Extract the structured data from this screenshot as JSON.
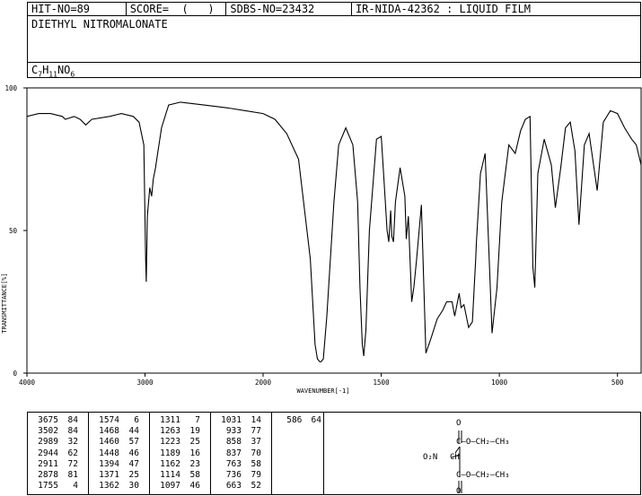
{
  "header": {
    "hit": "HIT-NO=89",
    "score": "SCORE=  (   )",
    "sdbs": "SDBS-NO=23432",
    "ir": "IR-NIDA-42362 : LIQUID FILM"
  },
  "compound_name": "DIETHYL NITROMALONATE",
  "formula": {
    "c": "C",
    "c_n": "7",
    "h": "H",
    "h_n": "11",
    "n": "NO",
    "o_n": "6"
  },
  "chart_data": {
    "type": "line",
    "xlabel": "WAVENUMBER[-1]",
    "ylabel": "TRANSMITTANCE[%]",
    "xlim": [
      4000,
      400
    ],
    "ylim": [
      0,
      100
    ],
    "x_ticks": [
      "4000",
      "3000",
      "2000",
      "1500",
      "1000",
      "500"
    ],
    "y_ticks": [
      "100",
      "50",
      "0"
    ],
    "series": [
      {
        "x": [
          4000,
          3900,
          3800,
          3700,
          3675,
          3600,
          3550,
          3502,
          3450,
          3300,
          3200,
          3100,
          3050,
          3010,
          2995,
          2989,
          2980,
          2960,
          2944,
          2930,
          2911,
          2890,
          2878,
          2860,
          2800,
          2700,
          2500,
          2300,
          2150,
          2000,
          1950,
          1900,
          1850,
          1800,
          1780,
          1770,
          1760,
          1755,
          1745,
          1730,
          1700,
          1680,
          1650,
          1620,
          1600,
          1590,
          1580,
          1574,
          1565,
          1550,
          1520,
          1500,
          1490,
          1475,
          1468,
          1460,
          1455,
          1448,
          1440,
          1420,
          1400,
          1394,
          1385,
          1371,
          1362,
          1350,
          1330,
          1311,
          1290,
          1263,
          1240,
          1223,
          1200,
          1189,
          1170,
          1162,
          1150,
          1130,
          1114,
          1100,
          1097,
          1080,
          1060,
          1031,
          1010,
          990,
          960,
          933,
          910,
          890,
          870,
          858,
          850,
          837,
          810,
          780,
          763,
          740,
          720,
          700,
          680,
          663,
          640,
          620,
          586,
          560,
          530,
          500,
          470,
          440,
          420,
          400
        ],
        "y": [
          90,
          91,
          91,
          90,
          89,
          90,
          89,
          87,
          89,
          90,
          91,
          90,
          88,
          80,
          40,
          32,
          55,
          65,
          62,
          68,
          72,
          78,
          81,
          86,
          94,
          95,
          94,
          93,
          92,
          91,
          89,
          84,
          75,
          40,
          10,
          5,
          4,
          4,
          5,
          20,
          60,
          80,
          86,
          80,
          60,
          30,
          10,
          6,
          15,
          50,
          82,
          83,
          70,
          50,
          46,
          57,
          48,
          46,
          60,
          72,
          62,
          47,
          55,
          25,
          30,
          40,
          59,
          7,
          12,
          19,
          22,
          25,
          25,
          20,
          28,
          23,
          24,
          16,
          18,
          40,
          46,
          70,
          77,
          14,
          30,
          60,
          80,
          77,
          85,
          89,
          90,
          37,
          30,
          70,
          82,
          73,
          58,
          72,
          86,
          88,
          78,
          52,
          80,
          84,
          64,
          88,
          92,
          91,
          86,
          82,
          80,
          73
        ]
      }
    ],
    "peak_table": [
      [
        3675,
        84
      ],
      [
        3502,
        84
      ],
      [
        2989,
        32
      ],
      [
        2944,
        62
      ],
      [
        2911,
        72
      ],
      [
        2878,
        81
      ],
      [
        1755,
        4
      ],
      [
        1574,
        6
      ],
      [
        1468,
        44
      ],
      [
        1460,
        57
      ],
      [
        1448,
        46
      ],
      [
        1394,
        47
      ],
      [
        1371,
        25
      ],
      [
        1362,
        30
      ],
      [
        1311,
        7
      ],
      [
        1263,
        19
      ],
      [
        1223,
        25
      ],
      [
        1189,
        16
      ],
      [
        1162,
        23
      ],
      [
        1114,
        58
      ],
      [
        1097,
        46
      ],
      [
        1031,
        14
      ],
      [
        933,
        77
      ],
      [
        858,
        37
      ],
      [
        837,
        70
      ],
      [
        763,
        58
      ],
      [
        736,
        79
      ],
      [
        663,
        52
      ],
      [
        586,
        64
      ]
    ]
  },
  "structure_labels": {
    "o_top": "O",
    "o_bottom": "O",
    "ester_top": "C—O—CH₂—CH₃",
    "ester_bottom": "C—O—CH₂—CH₃",
    "nitro": "O₂N",
    "ch": "CH"
  }
}
